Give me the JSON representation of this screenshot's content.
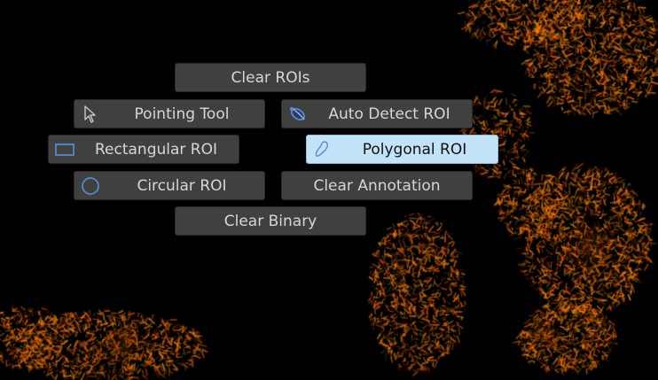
{
  "background": {
    "description_color": "#000000",
    "cell_stain_color": "#ff8c00"
  },
  "toolbar": {
    "clear_rois": "Clear ROIs",
    "pointing_tool": "Pointing Tool",
    "auto_detect_roi": "Auto Detect ROI",
    "rectangular_roi": "Rectangular ROI",
    "polygonal_roi": "Polygonal ROI",
    "circular_roi": "Circular ROI",
    "clear_annotation": "Clear Annotation",
    "clear_binary": "Clear Binary",
    "selected_tool": "Polygonal ROI"
  },
  "icons": {
    "pointing_tool": "cursor-arrow-icon",
    "auto_detect_roi": "auto-detect-lasso-icon",
    "rectangular_roi": "rectangle-icon",
    "polygonal_roi": "polygon-lasso-icon",
    "circular_roi": "circle-icon"
  },
  "colors": {
    "button_bg": "#404040",
    "button_text": "#d6d6d6",
    "selected_bg": "#c3e4f8",
    "icon_blue": "#5b8fd6"
  }
}
